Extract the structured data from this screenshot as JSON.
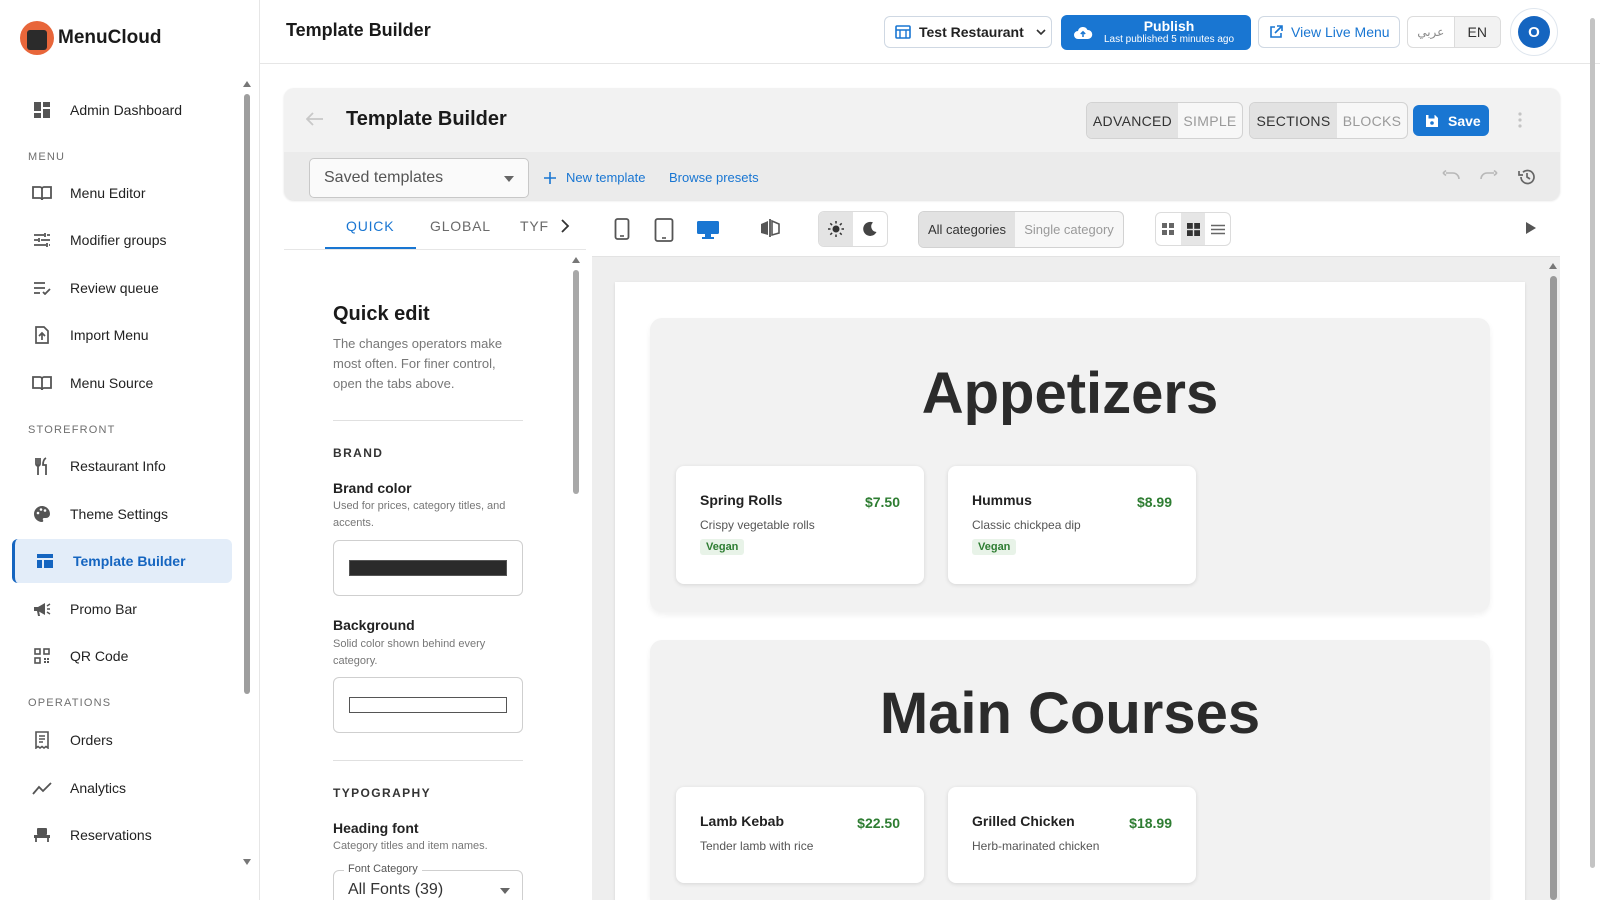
{
  "app": {
    "name": "MenuCloud"
  },
  "sidebar": {
    "items": [
      {
        "label": "Admin Dashboard"
      },
      {
        "label": "Menu Editor"
      },
      {
        "label": "Modifier groups"
      },
      {
        "label": "Review queue"
      },
      {
        "label": "Import Menu"
      },
      {
        "label": "Menu Source"
      },
      {
        "label": "Restaurant Info"
      },
      {
        "label": "Theme Settings"
      },
      {
        "label": "Template Builder"
      },
      {
        "label": "Promo Bar"
      },
      {
        "label": "QR Code"
      },
      {
        "label": "Orders"
      },
      {
        "label": "Analytics"
      },
      {
        "label": "Reservations"
      }
    ],
    "sections": {
      "menu": "MENU",
      "storefront": "STOREFRONT",
      "operations": "OPERATIONS"
    },
    "active_item": "Template Builder"
  },
  "topbar": {
    "title": "Template Builder",
    "restaurant": "Test Restaurant",
    "publish_label": "Publish",
    "publish_sub": "Last published 5 minutes ago",
    "view_live": "View Live Menu",
    "lang_ar": "عربي",
    "lang_en": "EN",
    "avatar_initial": "O"
  },
  "builder": {
    "title": "Template Builder",
    "mode_advanced": "ADVANCED",
    "mode_simple": "SIMPLE",
    "view_sections": "SECTIONS",
    "view_blocks": "BLOCKS",
    "save": "Save",
    "saved_templates": "Saved templates",
    "new_template": "New template",
    "browse_presets": "Browse presets"
  },
  "panel": {
    "tabs": [
      "QUICK",
      "GLOBAL",
      "TYF"
    ],
    "active_tab": "QUICK",
    "title": "Quick edit",
    "description": "The changes operators make most often. For finer control, open the tabs above.",
    "brand": {
      "heading": "BRAND",
      "brand_color_label": "Brand color",
      "brand_color_desc": "Used for prices, category titles, and accents.",
      "brand_color_value": "#2b2b2b",
      "background_label": "Background",
      "background_desc": "Solid color shown behind every category.",
      "background_value": "#ffffff"
    },
    "typography": {
      "heading": "TYPOGRAPHY",
      "heading_font_label": "Heading font",
      "heading_font_desc": "Category titles and item names.",
      "font_category_label": "Font Category",
      "font_category_value": "All Fonts (39)"
    }
  },
  "preview_toolbar": {
    "devices": [
      "mobile-icon",
      "tablet-icon",
      "desktop-icon",
      "split-view-icon"
    ],
    "active_device": "desktop",
    "theme": "light",
    "category_all": "All categories",
    "category_single": "Single category",
    "layout": "grid"
  },
  "preview": {
    "categories": [
      {
        "title": "Appetizers",
        "items": [
          {
            "name": "Spring Rolls",
            "price": "$7.50",
            "desc": "Crispy vegetable rolls",
            "tag": "Vegan"
          },
          {
            "name": "Hummus",
            "price": "$8.99",
            "desc": "Classic chickpea dip",
            "tag": "Vegan"
          }
        ]
      },
      {
        "title": "Main Courses",
        "items": [
          {
            "name": "Lamb Kebab",
            "price": "$22.50",
            "desc": "Tender lamb with rice"
          },
          {
            "name": "Grilled Chicken",
            "price": "$18.99",
            "desc": "Herb-marinated chicken"
          }
        ]
      }
    ]
  },
  "colors": {
    "accent": "#1976d2",
    "price": "#2e7d32",
    "active_nav_bg": "#e3edf9"
  }
}
